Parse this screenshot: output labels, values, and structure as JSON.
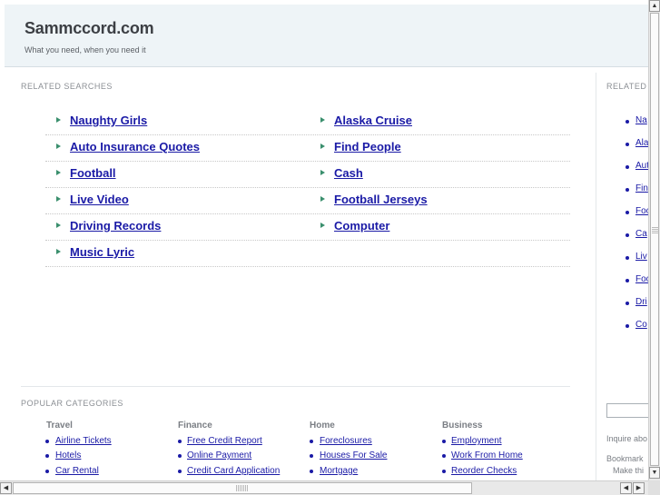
{
  "header": {
    "title": "Sammccord.com",
    "tagline": "What you need, when you need it"
  },
  "related_searches": {
    "label": "RELATED SEARCHES",
    "rows": [
      {
        "left": "Naughty Girls",
        "right": "Alaska Cruise"
      },
      {
        "left": "Auto Insurance Quotes",
        "right": "Find People"
      },
      {
        "left": "Football",
        "right": "Cash"
      },
      {
        "left": "Live Video",
        "right": "Football Jerseys"
      },
      {
        "left": "Driving Records",
        "right": "Computer"
      },
      {
        "left": "Music Lyric",
        "right": ""
      }
    ]
  },
  "right_column": {
    "label": "RELATED",
    "items": [
      "Na",
      "Ala",
      "Aut",
      "Fin",
      "Foo",
      "Ca",
      "Liv",
      "Foo",
      "Dri",
      "Co"
    ],
    "inquire_text": "Inquire abo",
    "bookmark_text": "Bookmark",
    "make_text": "Make thi"
  },
  "popular_categories": {
    "label": "POPULAR CATEGORIES",
    "columns": [
      {
        "heading": "Travel",
        "items": [
          "Airline Tickets",
          "Hotels",
          "Car Rental"
        ]
      },
      {
        "heading": "Finance",
        "items": [
          "Free Credit Report",
          "Online Payment",
          "Credit Card Application"
        ]
      },
      {
        "heading": "Home",
        "items": [
          "Foreclosures",
          "Houses For Sale",
          "Mortgage"
        ]
      },
      {
        "heading": "Business",
        "items": [
          "Employment",
          "Work From Home",
          "Reorder Checks"
        ]
      }
    ]
  },
  "scrollbars": {
    "up": "▲",
    "down": "▼",
    "left": "◀",
    "right": "▶"
  },
  "colors": {
    "link": "#1a1aa6",
    "arrow": "#3a8f6d",
    "header_bg": "#eef4f7"
  }
}
